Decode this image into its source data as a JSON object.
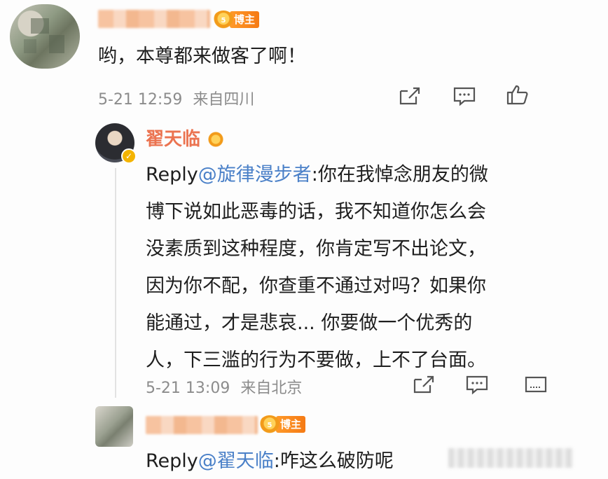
{
  "post": {
    "badge_label": "博主",
    "crown_level": "5",
    "text": "哟，本尊都来做客了啊！",
    "timestamp": "5-21 12:59",
    "source": "来自四川"
  },
  "reply1": {
    "author": "翟天临",
    "verified_mark": "✓",
    "prefix": "Reply",
    "mention": "@旋律漫步者",
    "lines": [
      ":你在我悼念朋友的微",
      "博下说如此恶毒的话，我不知道你怎么会",
      "没素质到这种程度，你肯定写不出论文，",
      "因为你不配，你查重不通过对吗？如果你",
      "能通过，才是悲哀... 你要做一个优秀的",
      "人，下三滥的行为不要做，上不了台面。"
    ],
    "timestamp": "5-21 13:09",
    "source": "来自北京"
  },
  "reply2": {
    "badge_label": "博主",
    "crown_level": "5",
    "prefix": "Reply",
    "mention": "@翟天临",
    "text": ":咋这么破防呢"
  },
  "icons": {
    "share": "share-icon",
    "comment": "comment-icon",
    "like": "like-icon",
    "more": "more-icon"
  },
  "colors": {
    "name": "#eb7350",
    "mention": "#4a80c8",
    "meta": "#8c8c8c",
    "badge": "#f57a14"
  }
}
